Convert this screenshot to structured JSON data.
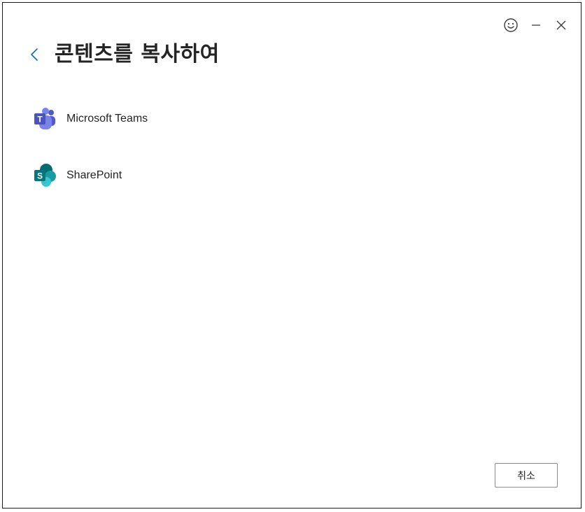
{
  "window": {
    "title": "콘텐츠를 복사하여"
  },
  "controls": {
    "feedback_icon": "smiley-icon",
    "minimize_icon": "minimize-icon",
    "close_icon": "close-icon"
  },
  "destinations": [
    {
      "label": "Microsoft Teams",
      "icon": "teams-icon"
    },
    {
      "label": "SharePoint",
      "icon": "sharepoint-icon"
    }
  ],
  "footer": {
    "cancel_label": "취소"
  },
  "colors": {
    "accent": "#0f6cbd",
    "teams": "#5059c9",
    "sharepoint": "#038387"
  }
}
